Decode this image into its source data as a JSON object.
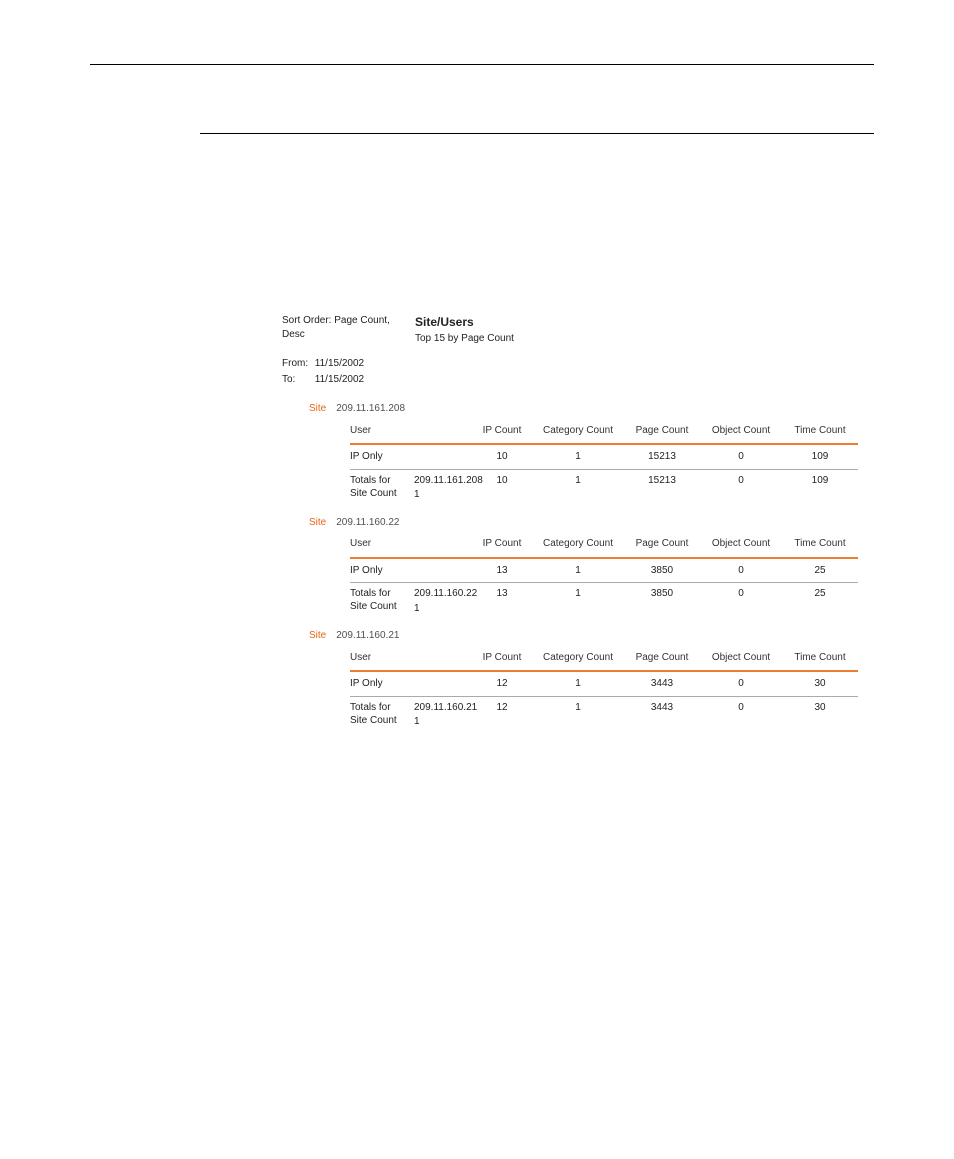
{
  "meta": {
    "sort_order_label": "Sort Order:",
    "sort_order_value": "Page Count, Desc",
    "from_label": "From:",
    "from_value": "11/15/2002",
    "to_label": "To:",
    "to_value": "11/15/2002"
  },
  "title": {
    "main": "Site/Users",
    "sub": "Top 15 by Page Count"
  },
  "headers": {
    "user": "User",
    "ip_count": "IP Count",
    "category_count": "Category Count",
    "page_count": "Page Count",
    "object_count": "Object Count",
    "time_count": "Time Count"
  },
  "totals_labels": {
    "totals_for": "Totals for",
    "site_count": "Site Count"
  },
  "sites": [
    {
      "label": "Site",
      "value": "209.11.161.208",
      "rows": [
        {
          "user": "IP Only",
          "ip": "10",
          "cat": "1",
          "page": "15213",
          "obj": "0",
          "time": "109"
        }
      ],
      "totals": {
        "site": "209.11.161.208",
        "site_count": "1",
        "ip": "10",
        "cat": "1",
        "page": "15213",
        "obj": "0",
        "time": "109"
      }
    },
    {
      "label": "Site",
      "value": "209.11.160.22",
      "rows": [
        {
          "user": "IP Only",
          "ip": "13",
          "cat": "1",
          "page": "3850",
          "obj": "0",
          "time": "25"
        }
      ],
      "totals": {
        "site": "209.11.160.22",
        "site_count": "1",
        "ip": "13",
        "cat": "1",
        "page": "3850",
        "obj": "0",
        "time": "25"
      }
    },
    {
      "label": "Site",
      "value": "209.11.160.21",
      "rows": [
        {
          "user": "IP Only",
          "ip": "12",
          "cat": "1",
          "page": "3443",
          "obj": "0",
          "time": "30"
        }
      ],
      "totals": {
        "site": "209.11.160.21",
        "site_count": "1",
        "ip": "12",
        "cat": "1",
        "page": "3443",
        "obj": "0",
        "time": "30"
      }
    }
  ]
}
